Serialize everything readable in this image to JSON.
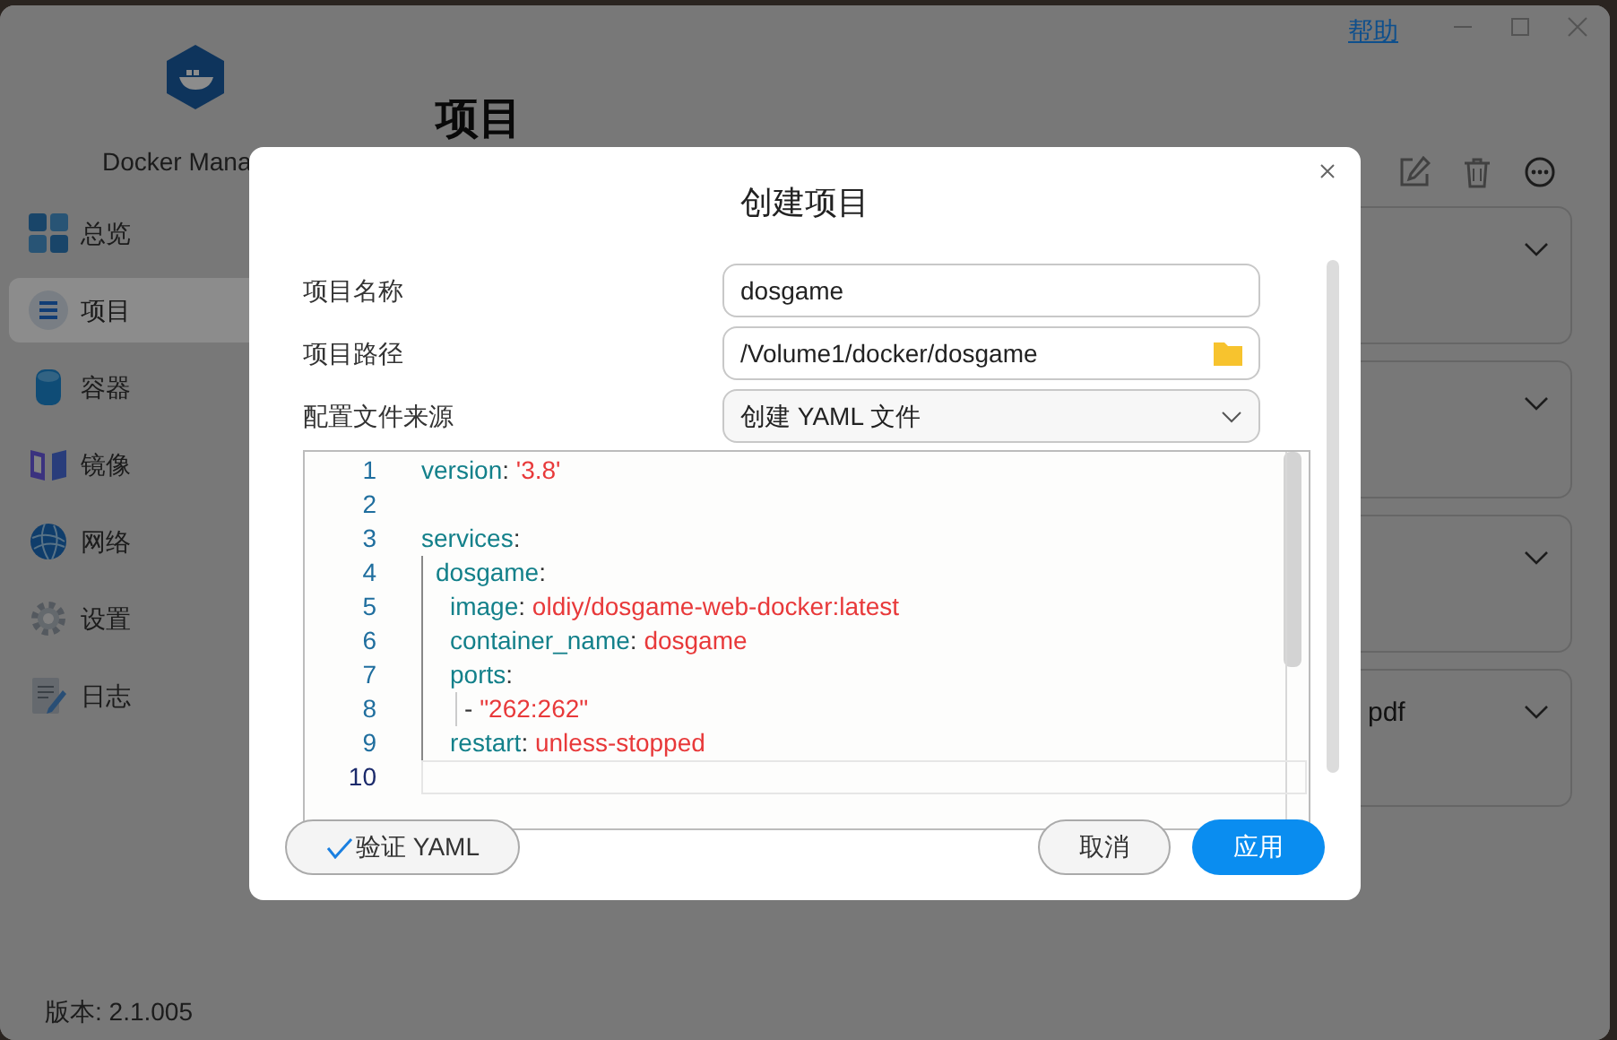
{
  "app": {
    "name": "Docker Mana",
    "help_link": "帮助",
    "version": "版本: 2.1.005"
  },
  "sidebar": {
    "items": [
      {
        "label": "总览",
        "kind": "overview",
        "selected": false
      },
      {
        "label": "项目",
        "kind": "project",
        "selected": true
      },
      {
        "label": "容器",
        "kind": "container",
        "selected": false
      },
      {
        "label": "镜像",
        "kind": "image",
        "selected": false
      },
      {
        "label": "网络",
        "kind": "network",
        "selected": false
      },
      {
        "label": "设置",
        "kind": "settings",
        "selected": false
      },
      {
        "label": "日志",
        "kind": "log",
        "selected": false
      }
    ]
  },
  "page": {
    "title": "项目",
    "cards": [
      {
        "kind": "blank"
      },
      {
        "kind": "blank"
      },
      {
        "kind": "blank"
      },
      {
        "kind": "titled",
        "title": "pdf"
      }
    ]
  },
  "dialog": {
    "title": "创建项目",
    "fields": [
      {
        "label": "项目名称",
        "kind": "text",
        "value": "dosgame"
      },
      {
        "label": "项目路径",
        "kind": "path",
        "value": "/Volume1/docker/dosgame"
      },
      {
        "label": "配置文件来源",
        "kind": "select",
        "value": "创建 YAML 文件"
      }
    ],
    "editor": {
      "lines": [
        {
          "number": "1",
          "current": false,
          "tokens": [
            {
              "kind": "key",
              "text": "version"
            },
            {
              "kind": "punct",
              "text": ": "
            },
            {
              "kind": "value",
              "text": "'3.8'"
            }
          ]
        },
        {
          "number": "2",
          "current": false
        },
        {
          "number": "3",
          "current": false,
          "tokens": [
            {
              "kind": "key",
              "text": "services"
            },
            {
              "kind": "punct",
              "text": ":"
            }
          ],
          "children": [
            {
              "number": "4",
              "current": false,
              "tokens": [
                {
                  "kind": "key",
                  "text": "dosgame"
                },
                {
                  "kind": "punct",
                  "text": ":"
                }
              ],
              "children": [
                {
                  "number": "5",
                  "current": false,
                  "tokens": [
                    {
                      "kind": "key",
                      "text": "image"
                    },
                    {
                      "kind": "punct",
                      "text": ": "
                    },
                    {
                      "kind": "value",
                      "text": "oldiy/dosgame-web-docker:latest"
                    }
                  ]
                },
                {
                  "number": "6",
                  "current": false,
                  "tokens": [
                    {
                      "kind": "key",
                      "text": "container_name"
                    },
                    {
                      "kind": "punct",
                      "text": ": "
                    },
                    {
                      "kind": "value",
                      "text": "dosgame"
                    }
                  ]
                },
                {
                  "number": "7",
                  "current": false,
                  "tokens": [
                    {
                      "kind": "key",
                      "text": "ports"
                    },
                    {
                      "kind": "punct",
                      "text": ":"
                    }
                  ],
                  "children": [
                    {
                      "number": "8",
                      "current": false,
                      "tokens": [
                        {
                          "kind": "punct",
                          "text": "- "
                        },
                        {
                          "kind": "value",
                          "text": "\"262:262\""
                        }
                      ]
                    }
                  ]
                },
                {
                  "number": "9",
                  "current": false,
                  "tokens": [
                    {
                      "kind": "key",
                      "text": "restart"
                    },
                    {
                      "kind": "punct",
                      "text": ": "
                    },
                    {
                      "kind": "value",
                      "text": "unless-stopped"
                    }
                  ]
                }
              ]
            }
          ]
        },
        {
          "number": "10",
          "current": true
        }
      ]
    },
    "buttons": {
      "validate": "验证 YAML",
      "cancel": "取消",
      "apply": "应用"
    }
  }
}
